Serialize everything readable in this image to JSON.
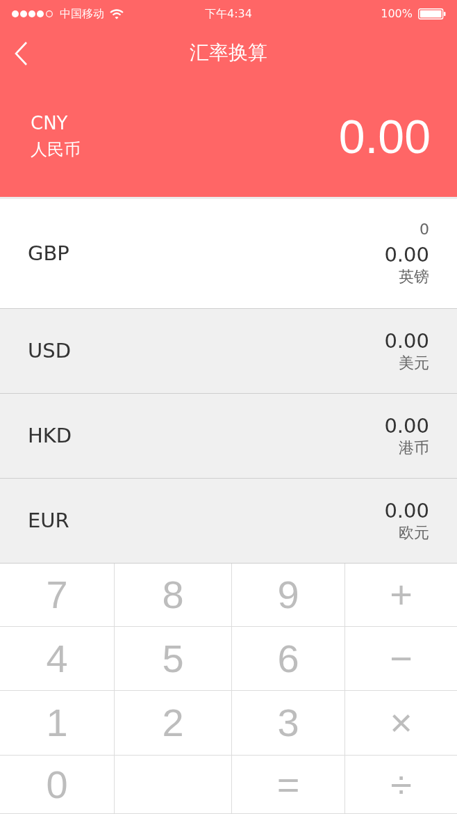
{
  "status_bar": {
    "carrier": "中国移动",
    "time": "下午4:34",
    "battery": "100%"
  },
  "nav_bar": {
    "title": "汇率换算"
  },
  "base_currency": {
    "code": "CNY",
    "name": "人民币",
    "amount": "0.00"
  },
  "currencies": [
    {
      "code": "GBP",
      "input": "0",
      "amount": "0.00",
      "name": "英镑",
      "selected": true
    },
    {
      "code": "USD",
      "amount": "0.00",
      "name": "美元",
      "selected": false
    },
    {
      "code": "HKD",
      "amount": "0.00",
      "name": "港币",
      "selected": false
    },
    {
      "code": "EUR",
      "amount": "0.00",
      "name": "欧元",
      "selected": false
    }
  ],
  "keypad": {
    "keys": [
      {
        "kind": "key",
        "label": "7"
      },
      {
        "kind": "key",
        "label": "8"
      },
      {
        "kind": "key",
        "label": "9"
      },
      {
        "kind": "key",
        "label": "+"
      },
      {
        "kind": "key",
        "label": "4"
      },
      {
        "kind": "key",
        "label": "5"
      },
      {
        "kind": "key",
        "label": "6"
      },
      {
        "kind": "key",
        "label": "−"
      },
      {
        "kind": "key",
        "label": "1"
      },
      {
        "kind": "key",
        "label": "2"
      },
      {
        "kind": "key",
        "label": "3"
      },
      {
        "kind": "key",
        "label": "×"
      },
      {
        "kind": "key",
        "label": "0"
      },
      {
        "kind": "blank"
      },
      {
        "kind": "key",
        "label": "="
      },
      {
        "kind": "key",
        "label": "÷"
      }
    ]
  }
}
